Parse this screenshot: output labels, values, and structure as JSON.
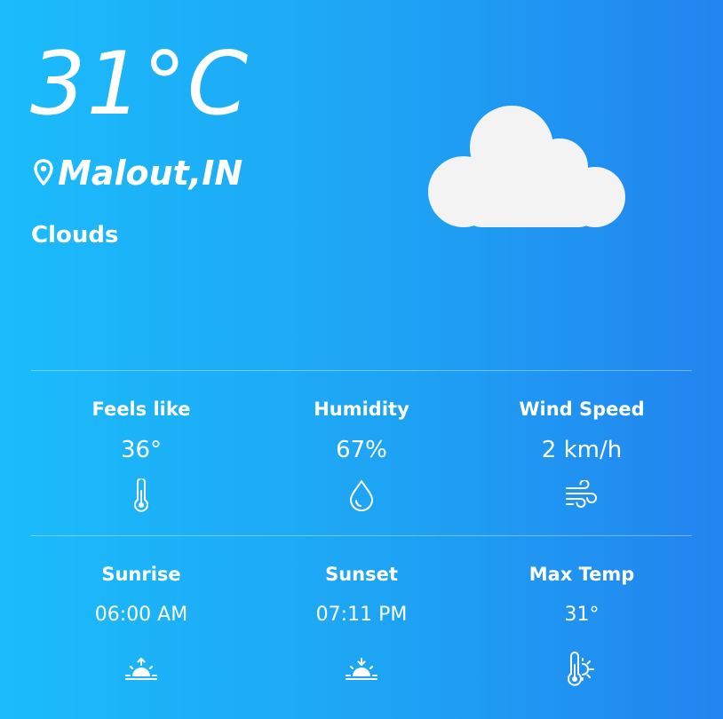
{
  "current": {
    "temperature": "31°C",
    "city": "Malout,IN",
    "condition": "Clouds",
    "condition_icon": "cloud-icon"
  },
  "details": [
    {
      "label": "Feels like",
      "value": "36°",
      "icon": "thermometer-icon"
    },
    {
      "label": "Humidity",
      "value": "67%",
      "icon": "water-drop-icon"
    },
    {
      "label": "Wind Speed",
      "value": "2 km/h",
      "icon": "wind-icon"
    },
    {
      "label": "Sunrise",
      "value": "06:00 AM",
      "icon": "sunrise-icon"
    },
    {
      "label": "Sunset",
      "value": "07:11 PM",
      "icon": "sunset-icon"
    },
    {
      "label": "Max Temp",
      "value": "31°",
      "icon": "thermometer-sun-icon"
    }
  ],
  "colors": {
    "background_left": "#1bbcfb",
    "background_right": "#2284ef",
    "text": "#ffffff",
    "cloud": "#f3f3f3"
  }
}
